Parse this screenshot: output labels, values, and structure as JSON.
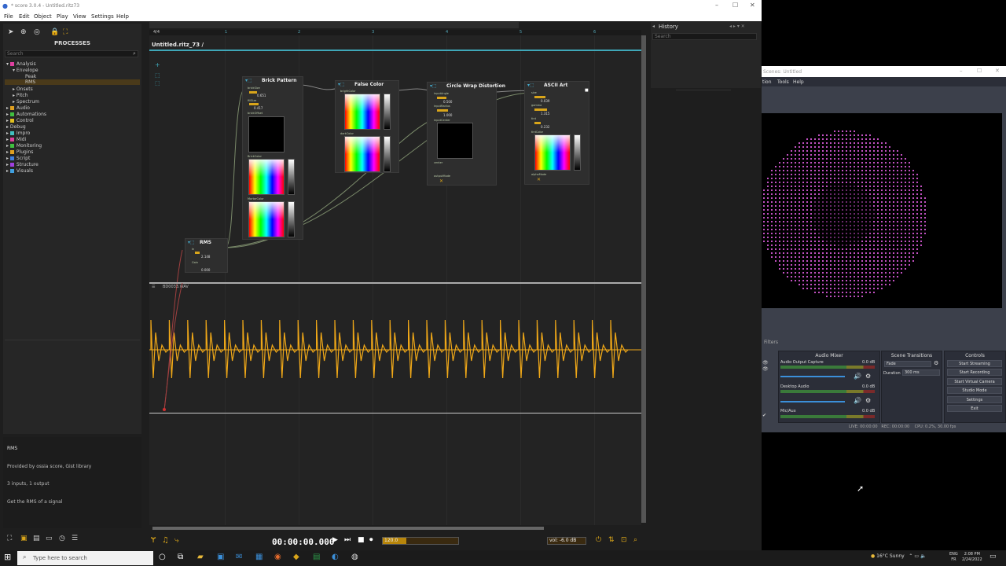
{
  "score": {
    "window_title": "* score 3.0.4 - Untitled.ritz73",
    "menu": [
      "File",
      "Edit",
      "Object",
      "Play",
      "View",
      "Settings",
      "Help"
    ],
    "processes_title": "PROCESSES",
    "search_placeholder": "Search",
    "tree": [
      {
        "label": "Analysis",
        "color": "#e040a0"
      },
      {
        "label": "Envelope",
        "color": ""
      },
      {
        "label": "Peak",
        "color": ""
      },
      {
        "label": "RMS",
        "color": ""
      },
      {
        "label": "Onsets",
        "color": ""
      },
      {
        "label": "Pitch",
        "color": ""
      },
      {
        "label": "Spectrum",
        "color": ""
      },
      {
        "label": "Audio",
        "color": "#e0a020"
      },
      {
        "label": "Automations",
        "color": "#40c040"
      },
      {
        "label": "Control",
        "color": "#e0c020"
      },
      {
        "label": "Debug",
        "color": ""
      },
      {
        "label": "Impro",
        "color": "#40c0c0"
      },
      {
        "label": "Midi",
        "color": "#e040a0"
      },
      {
        "label": "Monitoring",
        "color": "#40c040"
      },
      {
        "label": "Plugins",
        "color": "#e0a020"
      },
      {
        "label": "Script",
        "color": "#4080e0"
      },
      {
        "label": "Structure",
        "color": "#a040e0"
      },
      {
        "label": "Visuals",
        "color": "#40a0e0"
      }
    ],
    "info": {
      "name": "RMS",
      "provider": "Provided by ossia score, Gist library",
      "io": "3 inputs, 1 output",
      "description": "Get the RMS of a signal"
    },
    "ruler_ticks": [
      "0",
      "1",
      "2",
      "3",
      "4",
      "5",
      "6"
    ],
    "ruler_marker": "4/4",
    "doc_title": "Untitled.ritz_73 /",
    "audio_file": "BD0033.WAV",
    "nodes": {
      "brick": {
        "title": "Brick Pattern",
        "ports": [
          "brickSize",
          "fillSize",
          "brickOffset"
        ],
        "values": [
          "0.651",
          "0.417"
        ],
        "color_ports": [
          "BrickColor",
          "MortarColor"
        ]
      },
      "false_color": {
        "title": "False Color",
        "ports": [
          "brightColor",
          "darkColor"
        ]
      },
      "circle_wrap": {
        "title": "Circle Wrap Distortion",
        "ports": [
          "inputAngle",
          "inputRadius",
          "inputCenter",
          "center",
          "outputMode"
        ],
        "values": [
          "0.500",
          "1.000"
        ]
      },
      "ascii": {
        "title": "ASCII Art",
        "ports": [
          "size",
          "gamma",
          "tint",
          "tintColor",
          "alphaMode"
        ],
        "values": [
          "0.039",
          "1.315",
          "0.232"
        ]
      },
      "rms": {
        "title": "RMS",
        "ports": [
          "In",
          "Gain",
          "Out"
        ],
        "values": [
          "2.148",
          "0.000"
        ]
      }
    },
    "transport": {
      "time": "00:00:00.000",
      "tempo": "120.0",
      "volume": "vol: -6.0 dB"
    },
    "history": {
      "title": "History",
      "search_placeholder": "Search"
    }
  },
  "obs": {
    "title": "Scenes: Untitled",
    "menu": [
      "tion",
      "Tools",
      "Help"
    ],
    "filters": "Filters",
    "mixer_title": "Audio Mixer",
    "channels": [
      {
        "name": "Audio Output Capture",
        "db": "0.0 dB"
      },
      {
        "name": "Desktop Audio",
        "db": "0.0 dB"
      },
      {
        "name": "Mic/Aux",
        "db": "0.0 dB"
      }
    ],
    "transitions_title": "Scene Transitions",
    "transition": "Fade",
    "duration_label": "Duration",
    "duration": "300 ms",
    "controls_title": "Controls",
    "buttons": [
      "Start Streaming",
      "Start Recording",
      "Start Virtual Camera",
      "Studio Mode",
      "Settings",
      "Exit"
    ],
    "status": {
      "live": "LIVE: 00:00:00",
      "rec": "REC: 00:00:00",
      "cpu": "CPU: 0.2%, 30.00 fps"
    }
  },
  "taskbar": {
    "search": "Type here to search",
    "weather": "16°C  Sunny",
    "lang": "ENG",
    "lang2": "FR",
    "time": "2:08 PM",
    "date": "2/24/2022"
  }
}
